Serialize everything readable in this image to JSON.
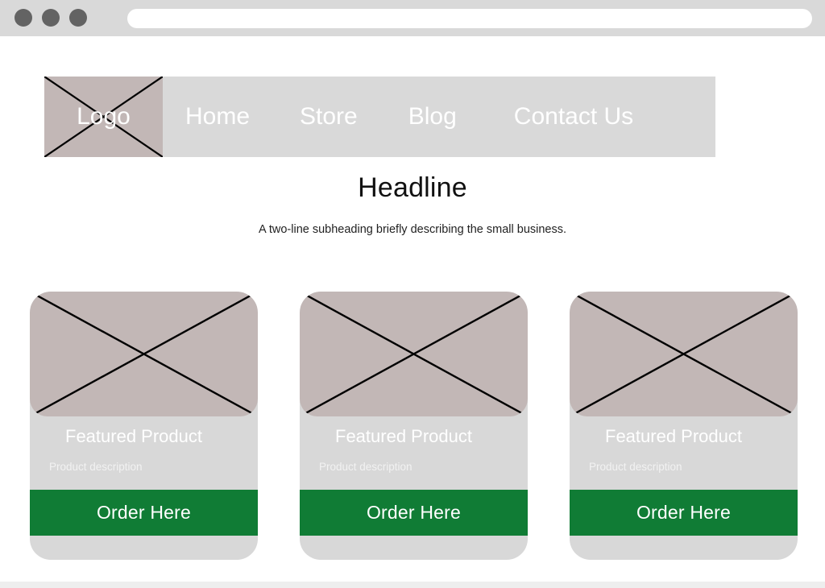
{
  "browser": {
    "window_dots": [
      "close-dot",
      "minimize-dot",
      "maximize-dot"
    ],
    "address_bar_value": "",
    "address_bar_placeholder": "",
    "chrome_color": "#d9d9d9",
    "dot_color": "#636363"
  },
  "site": {
    "navbar": {
      "logo_label": "Logo",
      "logo_placeholder_color": "#c2b7b6",
      "bar_color": "#d9d9d9",
      "links": [
        {
          "label": "Home"
        },
        {
          "label": "Store"
        },
        {
          "label": "Blog"
        },
        {
          "label": "Contact Us"
        }
      ]
    },
    "hero": {
      "headline": "Headline",
      "subheading": "A two-line subheading briefly describing the small business."
    },
    "cards": [
      {
        "title": "Featured Product",
        "description": "Product description",
        "button_label": "Order Here"
      },
      {
        "title": "Featured Product",
        "description": "Product description",
        "button_label": "Order Here"
      },
      {
        "title": "Featured Product",
        "description": "Product description",
        "button_label": "Order Here"
      }
    ],
    "theme": {
      "card_background": "#d8d8d8",
      "image_placeholder": "#c2b7b6",
      "accent_green": "#107C35",
      "text_on_accent": "#ffffff",
      "page_background": "#ffffff"
    }
  }
}
